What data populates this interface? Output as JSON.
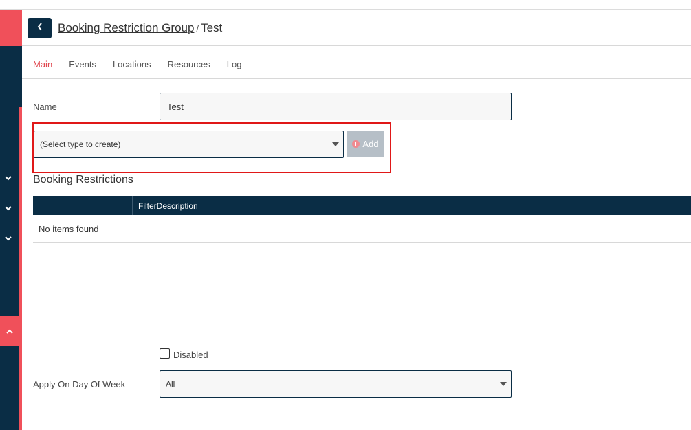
{
  "header": {
    "breadcrumb_link": "Booking Restriction Group",
    "separator": "/",
    "current": "Test"
  },
  "tabs": [
    {
      "label": "Main",
      "active": true
    },
    {
      "label": "Events",
      "active": false
    },
    {
      "label": "Locations",
      "active": false
    },
    {
      "label": "Resources",
      "active": false
    },
    {
      "label": "Log",
      "active": false
    }
  ],
  "form": {
    "name_label": "Name",
    "name_value": "Test",
    "type_select_value": "(Select type to create)",
    "add_label": "Add",
    "disabled_label": "Disabled",
    "disabled_checked": false,
    "day_of_week_label": "Apply On Day Of Week",
    "day_of_week_value": "All"
  },
  "booking_restrictions": {
    "title": "Booking Restrictions",
    "columns": [
      "",
      "FilterDescription"
    ],
    "empty_text": "No items found"
  },
  "icons": {
    "back": "chevron-left-icon",
    "add": "plus-circle-icon",
    "sidebar_expand": "chevron-down-icon",
    "sidebar_collapse": "chevron-up-icon"
  },
  "colors": {
    "navy": "#0a2d45",
    "accent": "#e0474f",
    "highlight": "#e01818"
  }
}
